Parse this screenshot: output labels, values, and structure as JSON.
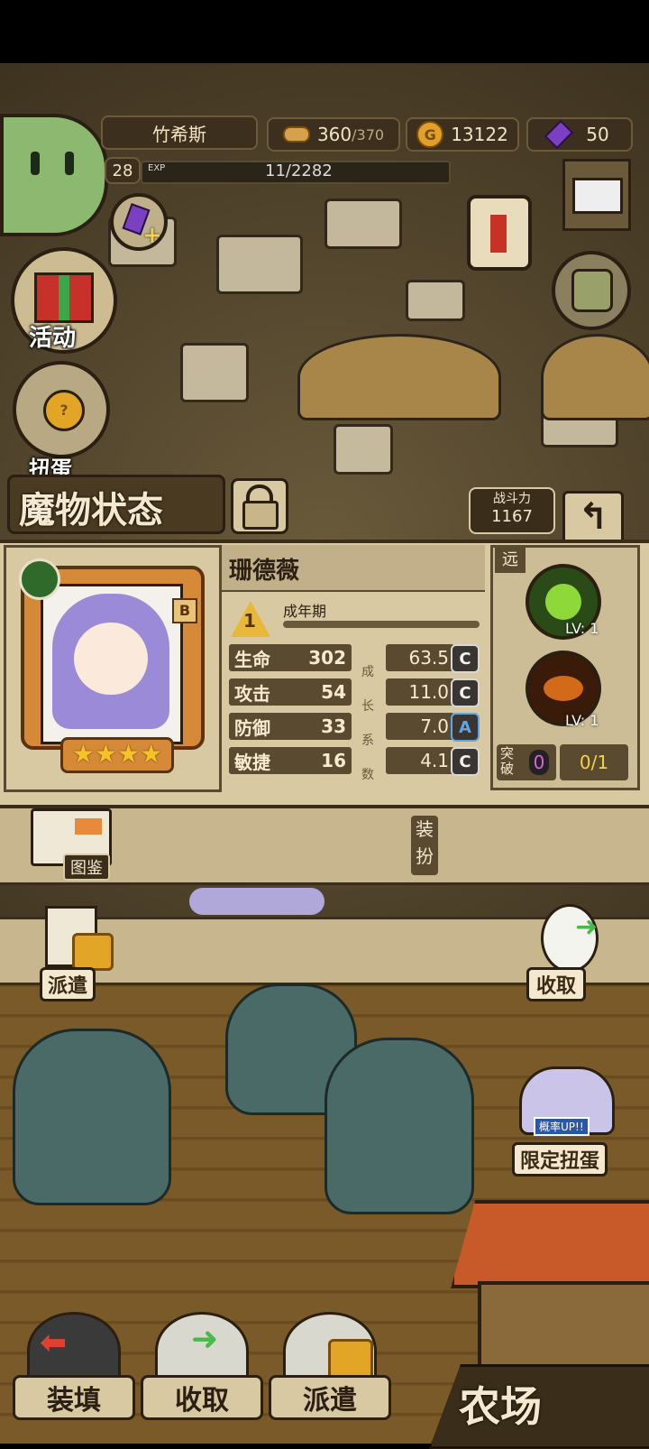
{
  "hud": {
    "player_name": "竹希斯",
    "level": "28",
    "exp_label": "EXP",
    "exp_value": "11/2282",
    "food_current": "360",
    "food_max": "/370",
    "gold": "13122",
    "gold_icon": "G",
    "gems": "50"
  },
  "left_menu": {
    "activity_label": "活动",
    "egg_label": "扭蛋"
  },
  "status": {
    "title": "魔物状态",
    "power_label": "战斗力",
    "power_value": "1167",
    "monster_name": "珊德薇",
    "rarity": "B",
    "stage_number": "1",
    "stage_label": "成年期",
    "range_tag": "远",
    "stars": "★★★★",
    "growth_vertical": [
      "成",
      "长",
      "系",
      "数"
    ],
    "stats": [
      {
        "label": "生命",
        "value": "302",
        "growth": "63.5",
        "grade": "C"
      },
      {
        "label": "攻击",
        "value": "54",
        "growth": "11.0",
        "grade": "C"
      },
      {
        "label": "防御",
        "value": "33",
        "growth": "7.0",
        "grade": "A"
      },
      {
        "label": "敏捷",
        "value": "16",
        "growth": "4.1",
        "grade": "C"
      }
    ],
    "skills": [
      {
        "level": "LV: 1"
      },
      {
        "level": "LV: 1"
      }
    ],
    "breakthrough_label": "突破",
    "breakthrough_count": "0",
    "breakthrough_progress": "0/1"
  },
  "mid_buttons": {
    "codex_label": "图鉴",
    "equip_label": "装扮",
    "dispatch_label": "派遣",
    "collect_label": "收取",
    "limited_label": "限定扭蛋",
    "rate_up_label": "概率UP!!"
  },
  "bottom_bar": {
    "load_label": "装填",
    "collect_label": "收取",
    "dispatch_label": "派遣",
    "farm_label": "农场"
  }
}
